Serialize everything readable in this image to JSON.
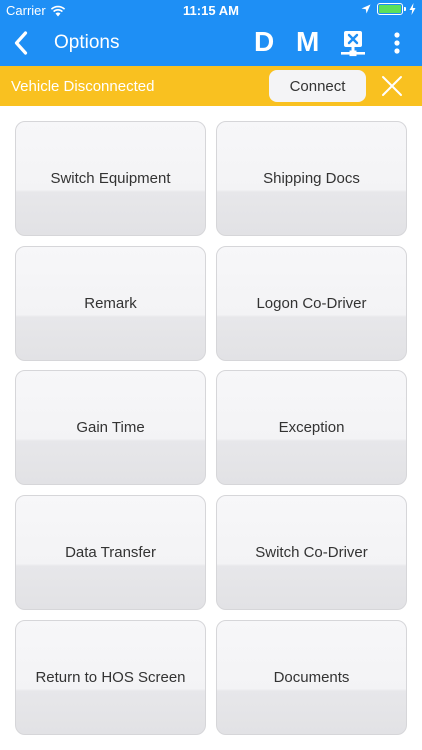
{
  "status_bar": {
    "carrier": "Carrier",
    "time": "11:15 AM"
  },
  "nav": {
    "title": "Options",
    "d_label": "D",
    "m_label": "M"
  },
  "banner": {
    "message": "Vehicle Disconnected",
    "connect_label": "Connect"
  },
  "options": [
    "Switch Equipment",
    "Shipping Docs",
    "Remark",
    "Logon Co-Driver",
    "Gain Time",
    "Exception",
    "Data Transfer",
    "Switch Co-Driver",
    "Return to HOS Screen",
    "Documents"
  ],
  "colors": {
    "primary": "#1e8ff5",
    "banner": "#f9c120",
    "battery": "#5be05b"
  }
}
